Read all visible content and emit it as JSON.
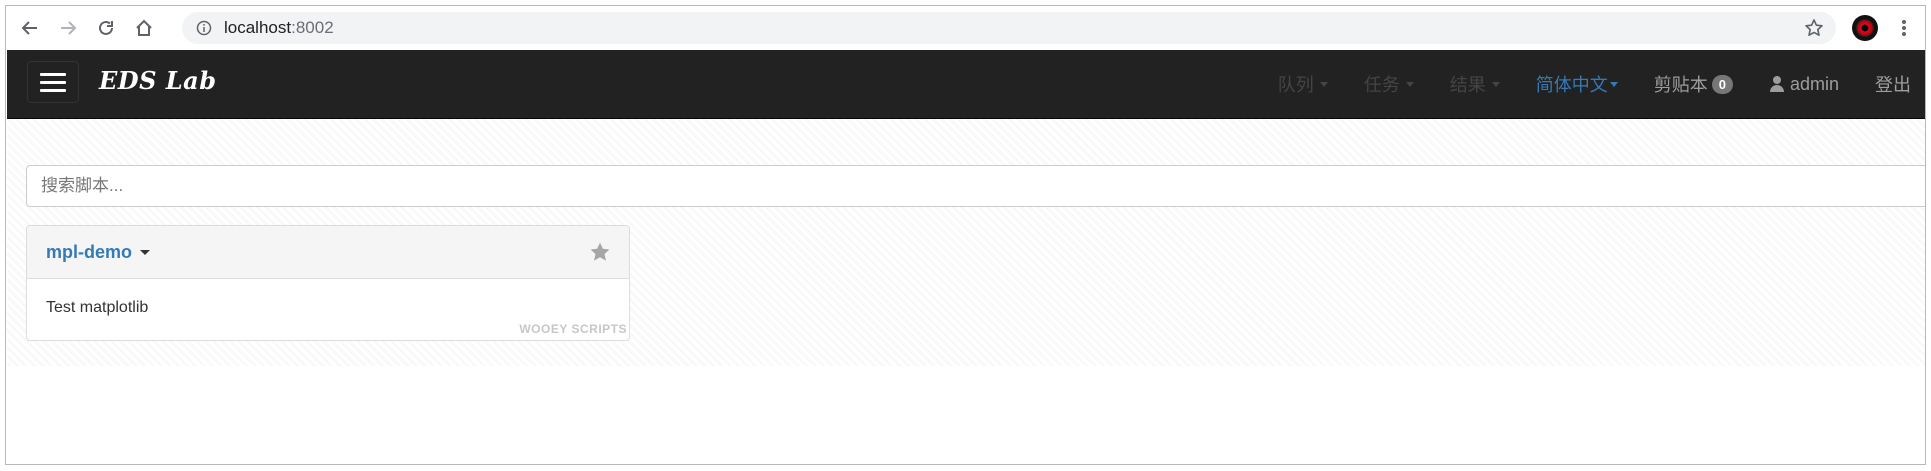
{
  "browser": {
    "url_host": "localhost",
    "url_port": ":8002"
  },
  "navbar": {
    "brand": "EDS Lab",
    "items": [
      {
        "label": "队列"
      },
      {
        "label": "任务"
      },
      {
        "label": "结果"
      }
    ],
    "language": "简体中文",
    "clipboard": {
      "label": "剪贴本",
      "count": "0"
    },
    "user": "admin",
    "logout": "登出"
  },
  "search": {
    "placeholder": "搜索脚本..."
  },
  "scripts": [
    {
      "name": "mpl-demo",
      "description": "Test matplotlib",
      "footer": "WOOEY SCRIPTS"
    }
  ],
  "colors": {
    "navbar_bg": "#222222",
    "link_blue": "#337ab7",
    "badge_gray": "#777777"
  },
  "icons": {
    "back": "arrow-left-icon",
    "forward": "arrow-right-icon",
    "reload": "reload-icon",
    "home": "home-icon",
    "info": "info-icon",
    "bookmark": "star-icon",
    "menu": "kebab-menu-icon",
    "user": "user-icon",
    "favorite": "star-icon"
  }
}
